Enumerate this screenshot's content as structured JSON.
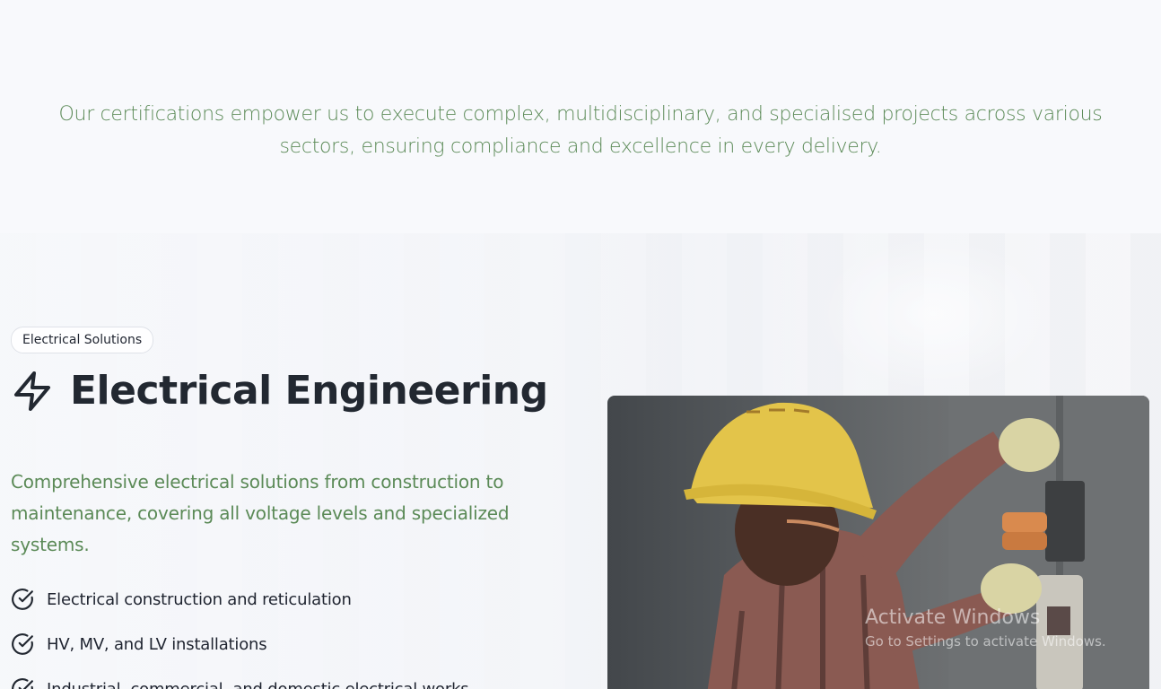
{
  "intro": {
    "text": "Our certifications empower us to execute complex, multidisciplinary, and specialised projects across various sectors, ensuring compliance and excellence in every delivery."
  },
  "section": {
    "badge": "Electrical Solutions",
    "title": "Electrical Engineering",
    "title_icon": "lightning-bolt-icon",
    "description": "Comprehensive electrical solutions from construction to maintenance, covering all voltage levels and specialized systems.",
    "features": [
      "Electrical construction and reticulation",
      "HV, MV, and LV installations",
      "Industrial, commercial, and domestic electrical works"
    ],
    "feature_icon": "check-circle-icon"
  },
  "watermark": {
    "title": "Activate Windows",
    "subtitle": "Go to Settings to activate Windows."
  },
  "colors": {
    "accent_green": "#5b8a57",
    "heading": "#222831",
    "background": "#f8f9fc"
  }
}
